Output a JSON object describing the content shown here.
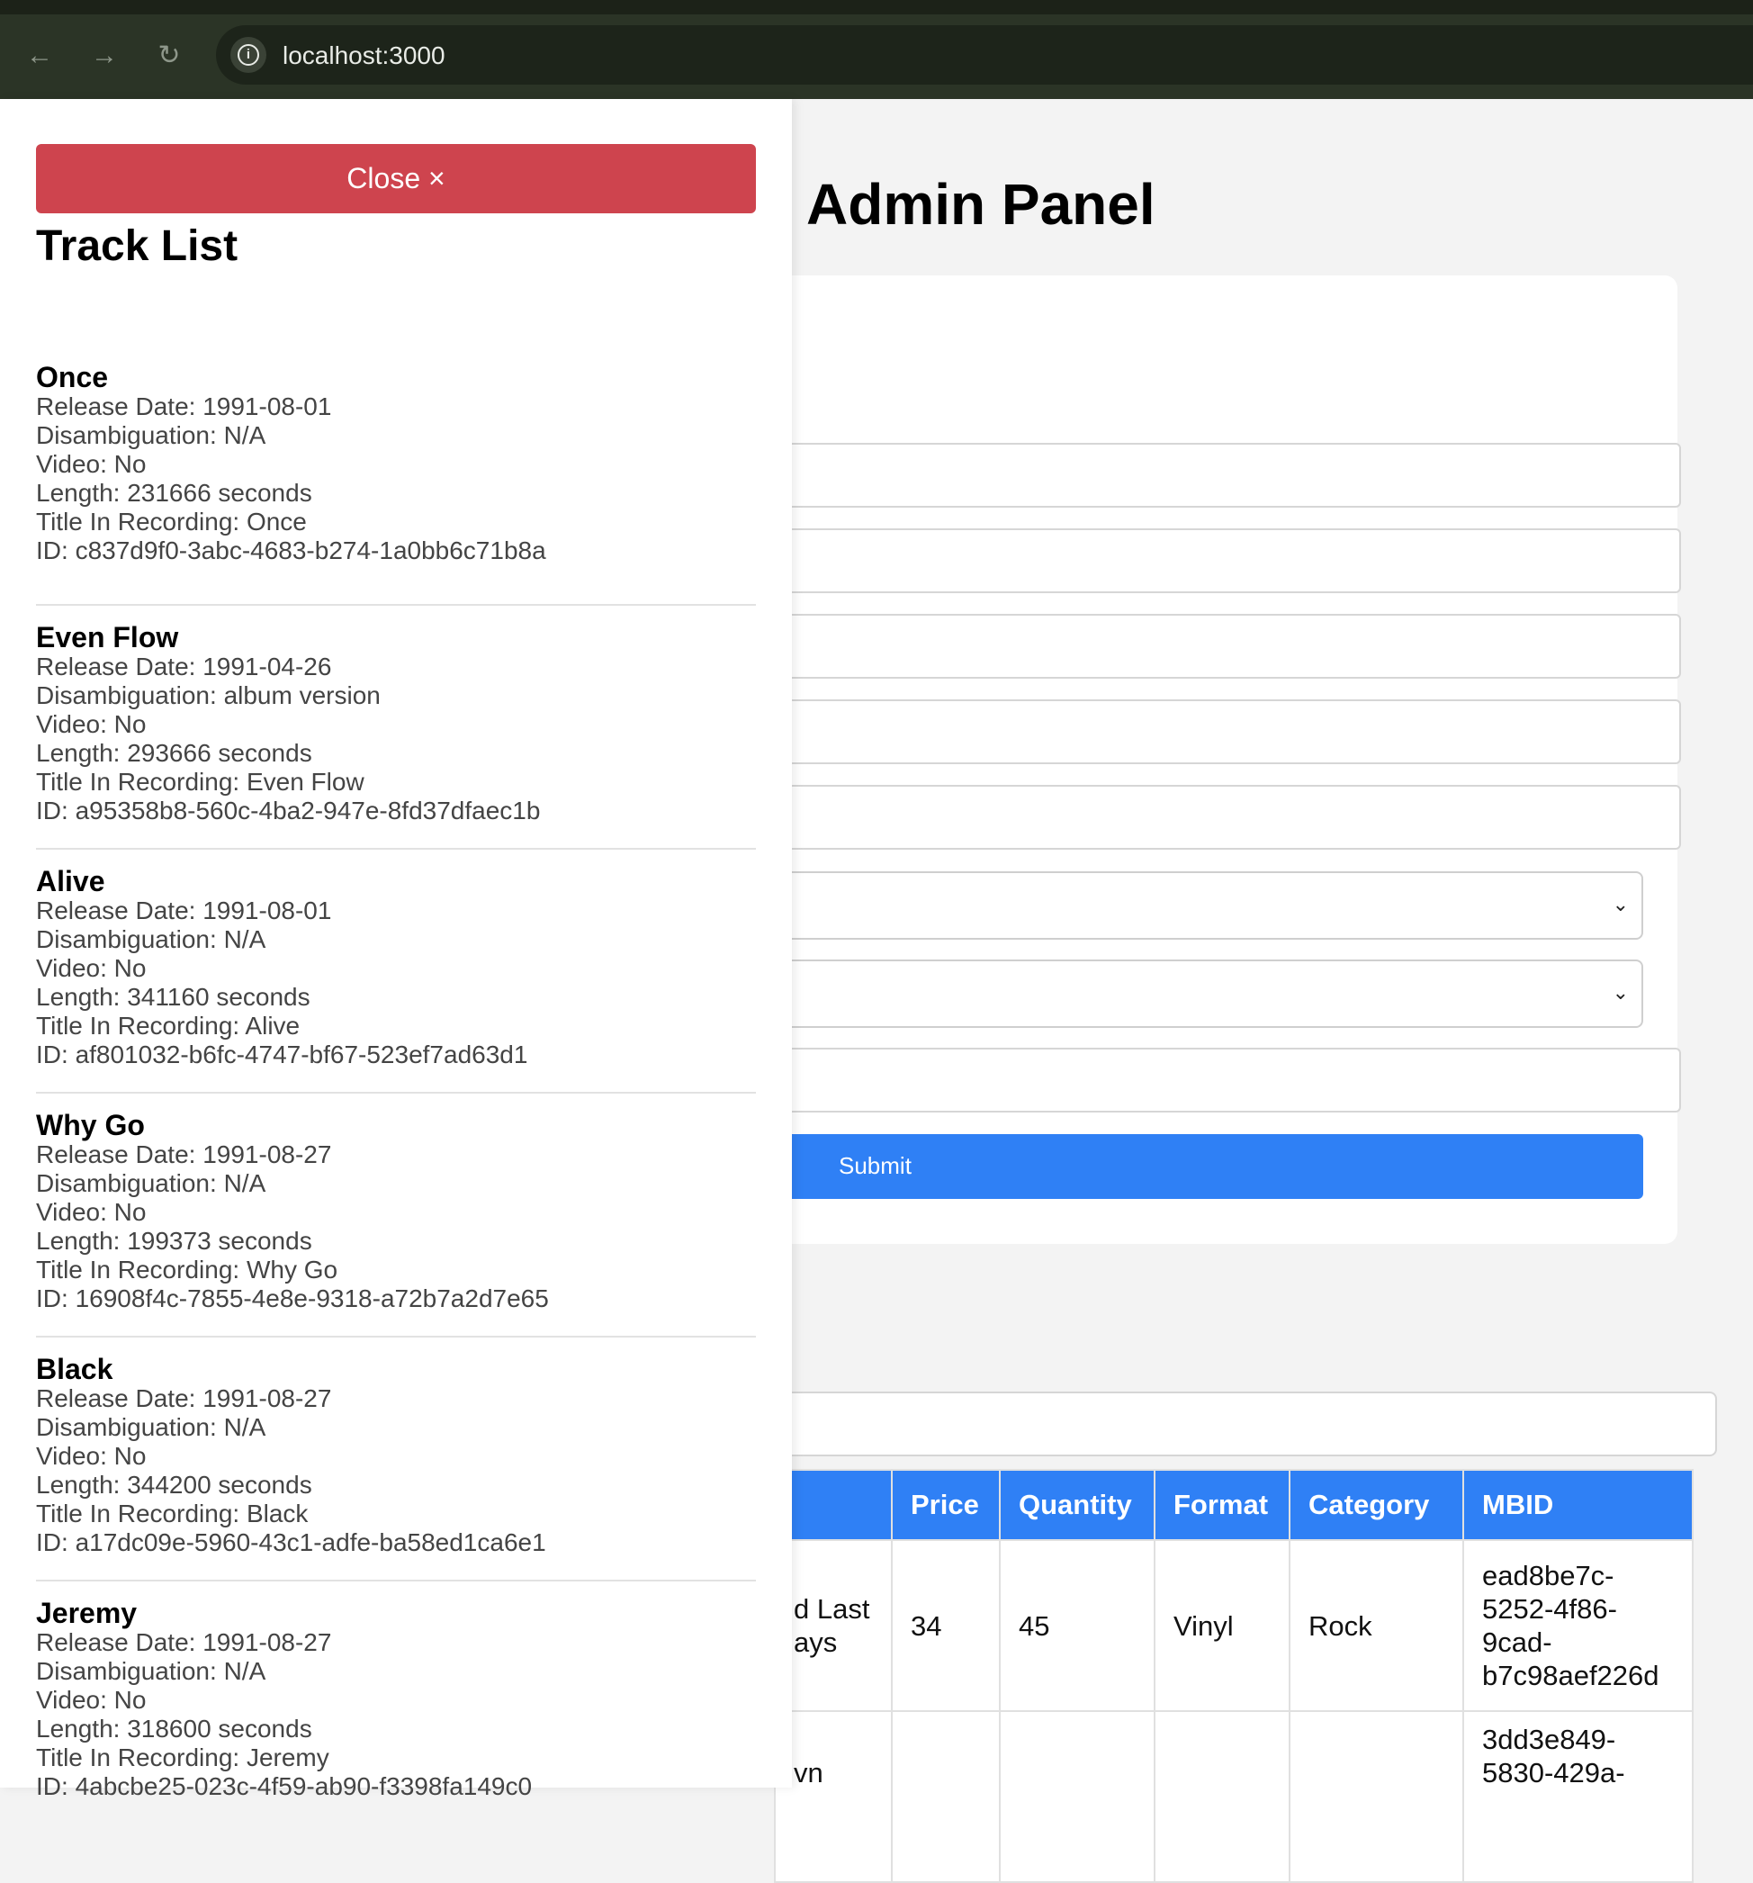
{
  "browser": {
    "url": "localhost:3000",
    "icons": {
      "back": "arrow-left-icon",
      "forward": "arrow-right-icon",
      "reload": "reload-icon",
      "info": "info-icon"
    }
  },
  "admin": {
    "title": "Admin Panel",
    "submit_label": "Submit"
  },
  "table": {
    "headers": [
      "",
      "Price",
      "Quantity",
      "Format",
      "Category",
      "MBID"
    ],
    "rows": [
      {
        "title": [
          "d Last",
          "ays"
        ],
        "price": "34",
        "quantity": "45",
        "format": "Vinyl",
        "category": "Rock",
        "mbid": [
          "ead8be7c-",
          "5252-4f86-",
          "9cad-",
          "b7c98aef226d"
        ]
      },
      {
        "title": [
          "",
          "vn"
        ],
        "price": "",
        "quantity": "",
        "format": "",
        "category": "",
        "mbid": [
          "3dd3e849-",
          "5830-429a-"
        ]
      }
    ]
  },
  "drawer": {
    "close_label": "Close ×",
    "title": "Track List",
    "labels": {
      "release_date": "Release Date: ",
      "disambiguation": "Disambiguation: ",
      "video": "Video: ",
      "length": "Length: ",
      "title_in_recording": "Title In Recording: ",
      "id": "ID: "
    },
    "tracks": [
      {
        "name": "Once",
        "release_date": "1991-08-01",
        "disambiguation": "N/A",
        "video": "No",
        "length": "231666 seconds",
        "title_in_recording": "Once",
        "id": "c837d9f0-3abc-4683-b274-1a0bb6c71b8a"
      },
      {
        "name": "Even Flow",
        "release_date": "1991-04-26",
        "disambiguation": "album version",
        "video": "No",
        "length": "293666 seconds",
        "title_in_recording": "Even Flow",
        "id": "a95358b8-560c-4ba2-947e-8fd37dfaec1b"
      },
      {
        "name": "Alive",
        "release_date": "1991-08-01",
        "disambiguation": "N/A",
        "video": "No",
        "length": "341160 seconds",
        "title_in_recording": "Alive",
        "id": "af801032-b6fc-4747-bf67-523ef7ad63d1"
      },
      {
        "name": "Why Go",
        "release_date": "1991-08-27",
        "disambiguation": "N/A",
        "video": "No",
        "length": "199373 seconds",
        "title_in_recording": "Why Go",
        "id": "16908f4c-7855-4e8e-9318-a72b7a2d7e65"
      },
      {
        "name": "Black",
        "release_date": "1991-08-27",
        "disambiguation": "N/A",
        "video": "No",
        "length": "344200 seconds",
        "title_in_recording": "Black",
        "id": "a17dc09e-5960-43c1-adfe-ba58ed1ca6e1"
      },
      {
        "name": "Jeremy",
        "release_date": "1991-08-27",
        "disambiguation": "N/A",
        "video": "No",
        "length": "318600 seconds",
        "title_in_recording": "Jeremy",
        "id": "4abcbe25-023c-4f59-ab90-f3398fa149c0"
      }
    ]
  },
  "colors": {
    "accent": "#2f80f5",
    "close": "#ce444e",
    "chrome": "#2b3426"
  }
}
